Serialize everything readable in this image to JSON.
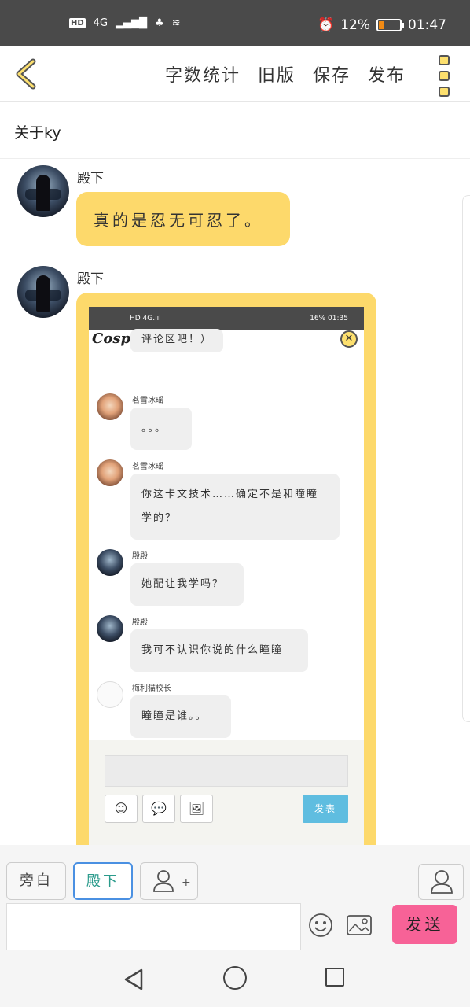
{
  "status_bar": {
    "hd_label": "HD",
    "network": "4G",
    "battery_percent_text": "12%",
    "battery_level": 0.12,
    "time": "01:47"
  },
  "toolbar": {
    "word_count": "字数统计",
    "old_version": "旧版",
    "save": "保存",
    "publish": "发布"
  },
  "subtitle": "关于ky",
  "messages": [
    {
      "sender": "殿下",
      "text": "真的是忍无可忍了。"
    },
    {
      "sender": "殿下"
    }
  ],
  "embedded": {
    "status_left": "HD 4G.ııl",
    "status_right": "16% 01:35",
    "title": "Cosplay",
    "close_icon": "✕",
    "messages": [
      {
        "name": "",
        "text": "评论区吧！）",
        "avatar": "none"
      },
      {
        "name": "茗雪冰瑶",
        "text": "。。。",
        "avatar": "a1"
      },
      {
        "name": "茗雪冰瑶",
        "text": "你这卡文技术……确定不是和瞳瞳学的？",
        "avatar": "a1"
      },
      {
        "name": "殿殿",
        "text": "她配让我学吗？",
        "avatar": "a2"
      },
      {
        "name": "殿殿",
        "text": "我可不认识你说的什么瞳瞳",
        "avatar": "a2"
      },
      {
        "name": "梅利猫校长",
        "text": "瞳瞳是谁。。",
        "avatar": "a3"
      }
    ],
    "post_button": "发表",
    "buttons": [
      "☺",
      "💬",
      "🖼"
    ]
  },
  "composer": {
    "narration": "旁白",
    "current_role": "殿下",
    "add_role_symbol": "+",
    "send": "发送"
  },
  "icons": [
    "back-chevron-icon",
    "more-menu-icon",
    "emoji-icon",
    "image-icon",
    "person-icon",
    "nav-back-icon",
    "nav-home-icon",
    "nav-recent-icon"
  ],
  "colors": {
    "accent_yellow": "#fdd96b",
    "send_pink": "#f76297",
    "post_blue": "#5fbde0"
  }
}
